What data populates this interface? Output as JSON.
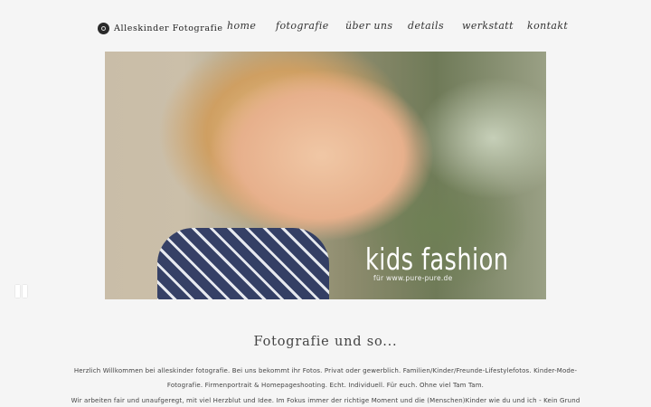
{
  "header": {
    "brand": "Alleskinder Fotografie",
    "nav": [
      "home",
      "fotografie",
      "über uns",
      "details",
      "werkstatt",
      "kontakt"
    ]
  },
  "hero": {
    "title": "kids fashion",
    "subtitle": "für www.pure-pure.de"
  },
  "intro": {
    "heading": "Fotografie und so...",
    "lines": [
      "Herzlich Willkommen bei alleskinder fotografie. Bei uns bekommt ihr Fotos. Privat oder gewerblich. Familien/Kinder/Freunde-Lifestylefotos. Kinder-Mode-",
      "Fotografie. Firmenportrait & Homepageshooting. Echt. Individuell. Für euch. Ohne viel Tam Tam.",
      "Wir arbeiten fair und unaufgeregt, mit viel Herzblut und Idee. Im Fokus immer der richtige Moment und die (Menschen)Kinder wie du und ich - Kein Grund"
    ]
  }
}
